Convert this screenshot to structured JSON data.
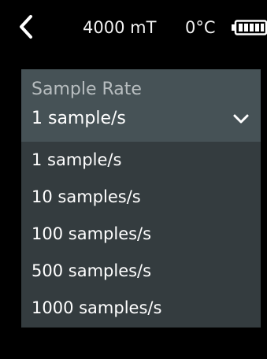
{
  "status": {
    "magnetic_field": "4000 mT",
    "temperature": "0°C",
    "battery_icon": "battery-full-icon"
  },
  "sample_rate": {
    "label": "Sample Rate",
    "selected": "1 sample/s",
    "options": [
      "1 sample/s",
      "10 samples/s",
      "100 samples/s",
      "500 samples/s",
      "1000 samples/s"
    ]
  },
  "colors": {
    "background": "#000000",
    "header_bg": "#465256",
    "options_bg": "#343c3f",
    "label_text": "#b8bec0",
    "text": "#ffffff"
  }
}
